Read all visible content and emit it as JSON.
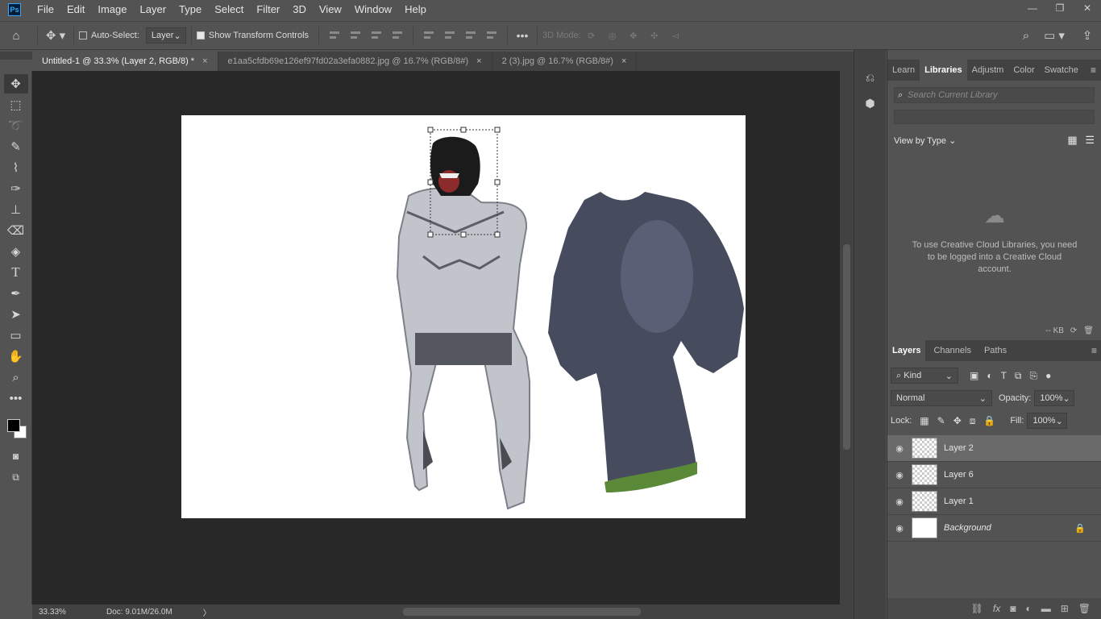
{
  "menu": {
    "logo": "Ps",
    "items": [
      "File",
      "Edit",
      "Image",
      "Layer",
      "Type",
      "Select",
      "Filter",
      "3D",
      "View",
      "Window",
      "Help"
    ]
  },
  "window_controls": {
    "minimize": "—",
    "restore": "❐",
    "close": "✕"
  },
  "options": {
    "auto_select_label": "Auto-Select:",
    "auto_select_value": "Layer",
    "transform_label": "Show Transform Controls",
    "mode_label": "3D Mode:"
  },
  "tabs": [
    {
      "label": "Untitled-1 @ 33.3% (Layer 2, RGB/8) *",
      "close": "×"
    },
    {
      "label": "e1aa5cfdb69e126ef97fd02a3efa0882.jpg @ 16.7% (RGB/8#)",
      "close": "×"
    },
    {
      "label": "2 (3).jpg @ 16.7% (RGB/8#)",
      "close": "×"
    }
  ],
  "status": {
    "zoom": "33.33%",
    "doc": "Doc: 9.01M/26.0M",
    "arrow": "〉"
  },
  "panel_tabs": [
    "Learn",
    "Libraries",
    "Adjustm",
    "Color",
    "Swatche"
  ],
  "libraries": {
    "search_placeholder": "Search Current Library",
    "view_by": "View by Type",
    "message": "To use Creative Cloud Libraries, you need to be logged into a Creative Cloud account.",
    "footer_size": "-- KB"
  },
  "layers_tabs": [
    "Layers",
    "Channels",
    "Paths"
  ],
  "layers": {
    "filter_kind": "Kind",
    "blend_mode": "Normal",
    "opacity_label": "Opacity:",
    "opacity_value": "100%",
    "lock_label": "Lock:",
    "fill_label": "Fill:",
    "fill_value": "100%",
    "rows": [
      {
        "name": "Layer 2"
      },
      {
        "name": "Layer 6"
      },
      {
        "name": "Layer 1"
      },
      {
        "name": "Background"
      }
    ]
  },
  "colors": {
    "accent": "#31a8ff",
    "workspace": "#282828",
    "panel": "#535353"
  }
}
